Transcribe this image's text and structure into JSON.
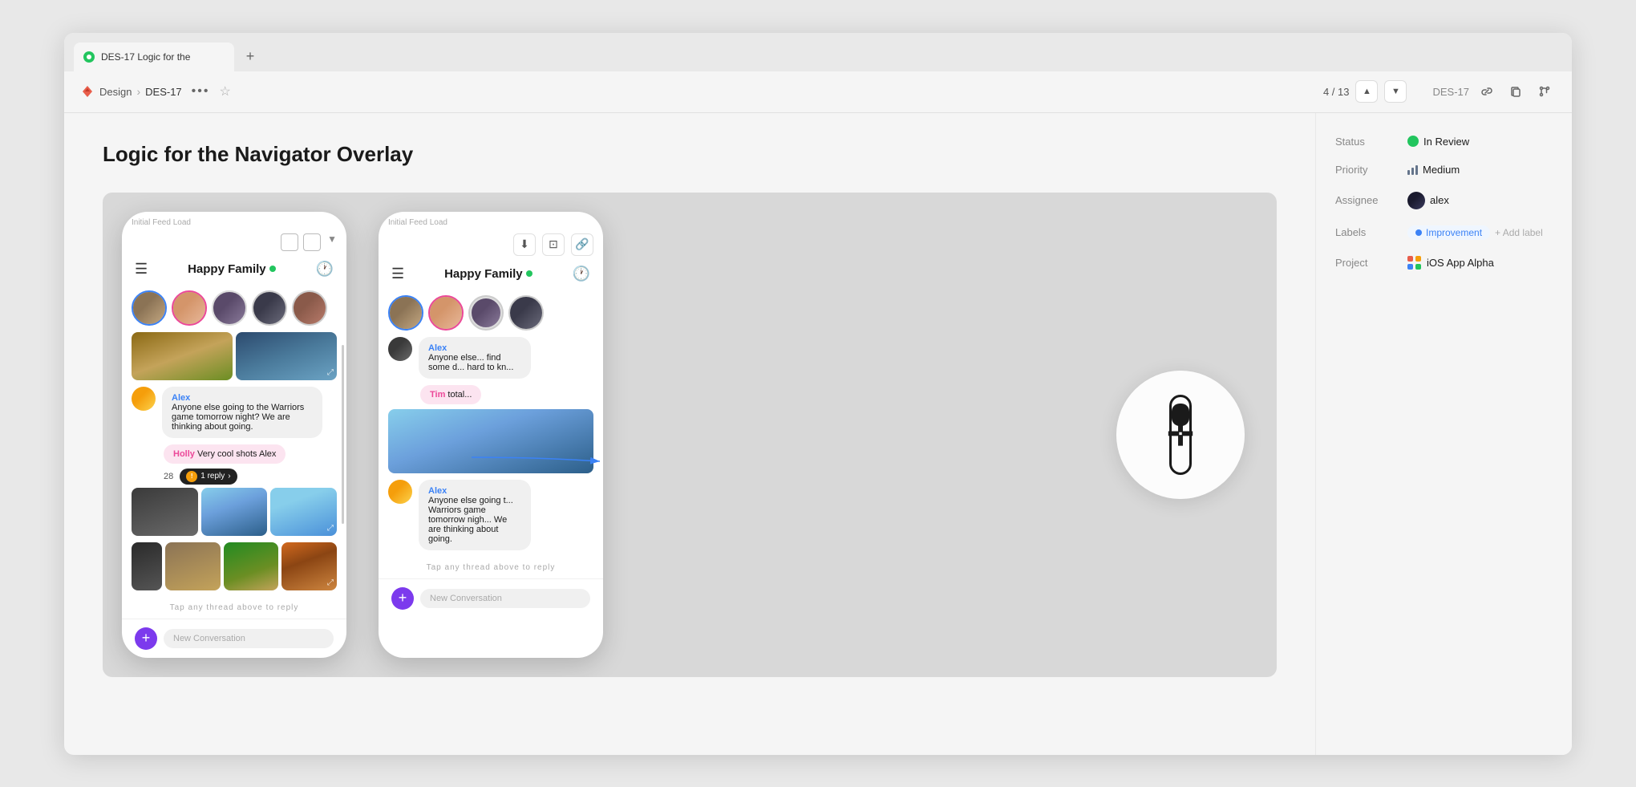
{
  "browser": {
    "tab_title": "DES-17 Logic for the",
    "tab_new_label": "+",
    "breadcrumb_app": "Design",
    "breadcrumb_issue": "DES-17",
    "more_dots": "•••",
    "star": "☆",
    "pagination": "4 / 13",
    "issue_id": "DES-17"
  },
  "page": {
    "title": "Logic for the Navigator Overlay"
  },
  "phones": {
    "left_label": "Initial Feed Load",
    "right_label": "Initial Feed Load",
    "group_name": "Happy Family",
    "new_conversation_placeholder": "New Conversation",
    "tap_reply": "Tap any thread above to reply",
    "messages": [
      {
        "sender": "Alex",
        "text": "Anyone else going to the Warriors game tomorrow night? We are thinking about going."
      },
      {
        "sender": "Holly",
        "text": "Very cool shots Alex"
      },
      {
        "sender": "Tim",
        "text": "totally"
      },
      {
        "sender": "Alex",
        "text": "Anyone else going to the Warriors game tomorrow night? We are thinking about going."
      }
    ],
    "reply_badge": "1 reply",
    "number_28": "28"
  },
  "right_panel": {
    "status_label": "Status",
    "status_value": "In Review",
    "priority_label": "Priority",
    "priority_value": "Medium",
    "assignee_label": "Assignee",
    "assignee_value": "alex",
    "labels_label": "Labels",
    "labels_value": "Improvement",
    "add_label": "+ Add label",
    "project_label": "Project",
    "project_value": "iOS App Alpha"
  },
  "toolbar_actions": {
    "link_icon": "🔗",
    "copy_icon": "⊡",
    "branch_icon": "⎇"
  }
}
